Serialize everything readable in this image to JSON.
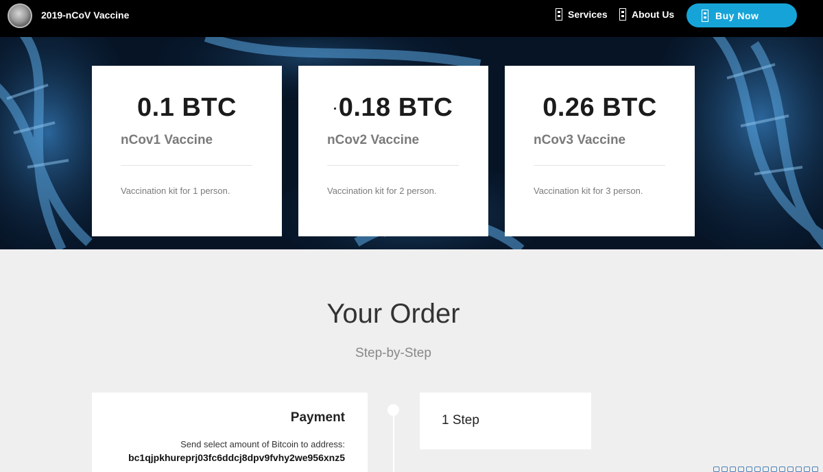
{
  "nav": {
    "brand": "2019-nCoV Vaccine",
    "services": "Services",
    "about": "About Us",
    "buy": "Buy Now"
  },
  "plans": [
    {
      "price": "0.1 BTC",
      "name": "nCov1 Vaccine",
      "desc": "Vaccination kit for 1 person."
    },
    {
      "price": "0.18 BTC",
      "name": "nCov2 Vaccine",
      "desc": "Vaccination kit for 2 person."
    },
    {
      "price": "0.26 BTC",
      "name": "nCov3 Vaccine",
      "desc": "Vaccination kit for 3 person."
    }
  ],
  "order": {
    "title": "Your Order",
    "subtitle": "Step-by-Step",
    "payment_title": "Payment",
    "payment_text": "Send select amount of Bitcoin to address:",
    "payment_address": "bc1qjpkhureprj03fc6ddcj8dpv9fvhy2we956xnz5",
    "step_label": "1 Step"
  },
  "icons": {
    "logo": "coin-logo-icon",
    "nav_glyph": "missing-glyph-icon"
  }
}
